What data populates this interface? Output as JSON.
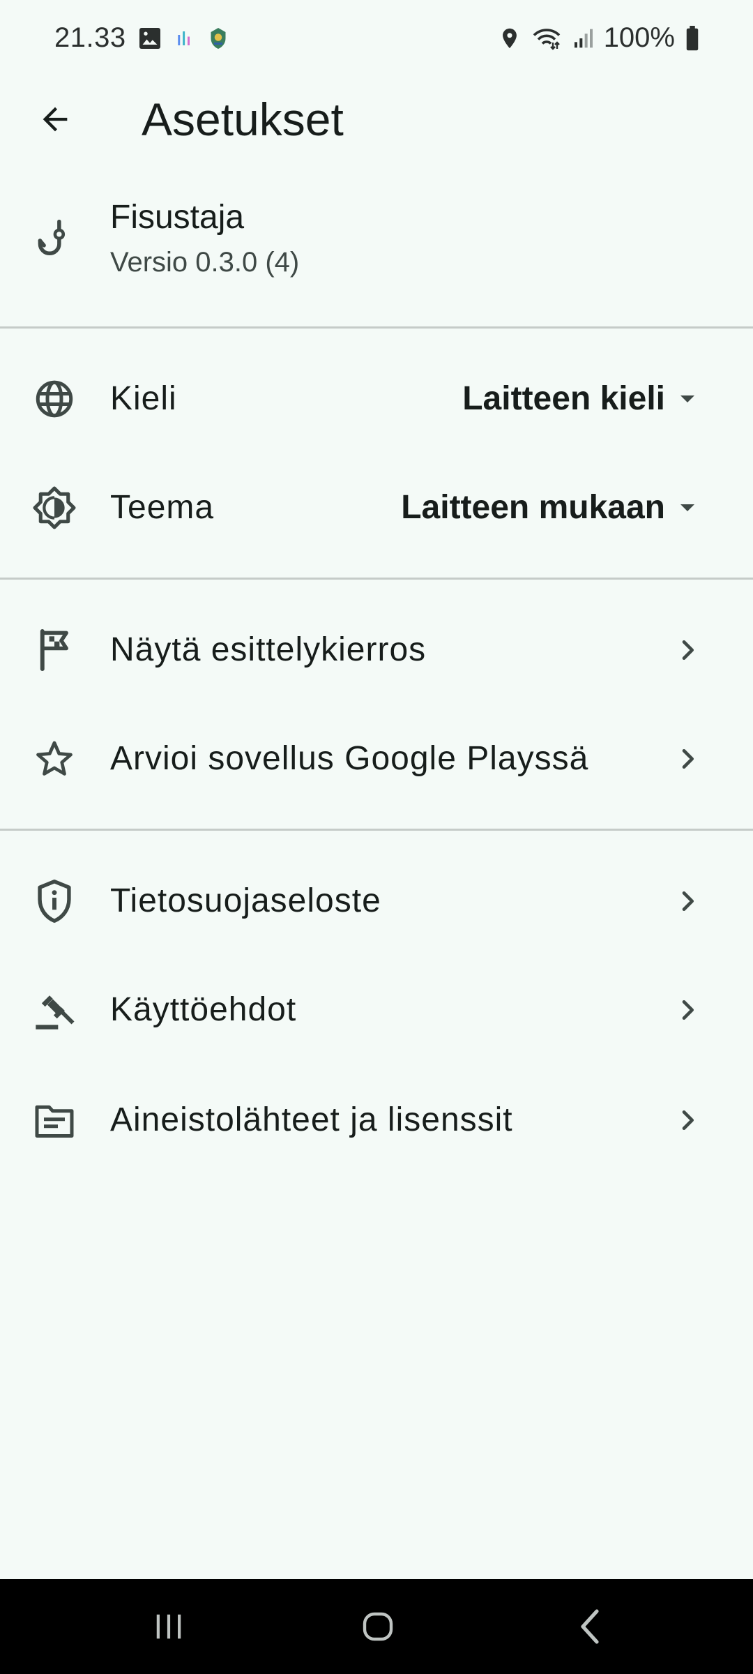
{
  "status_bar": {
    "time": "21.33",
    "battery": "100%",
    "icons": [
      "image-icon",
      "equalizer-icon",
      "app-emblem-icon",
      "location-icon",
      "wifi-icon",
      "signal-icon",
      "battery-icon"
    ]
  },
  "app_bar": {
    "title": "Asetukset",
    "back_icon": "arrow-back-icon"
  },
  "app_info": {
    "name": "Fisustaja",
    "version": "Versio 0.3.0 (4)",
    "icon": "fishing-hook-icon"
  },
  "settings": {
    "language": {
      "label": "Kieli",
      "value": "Laitteen kieli",
      "icon": "globe-icon"
    },
    "theme": {
      "label": "Teema",
      "value": "Laitteen mukaan",
      "icon": "brightness-icon"
    }
  },
  "links": {
    "tour": {
      "label": "Näytä esittelykierros",
      "icon": "flag-icon"
    },
    "rate": {
      "label": "Arvioi sovellus Google Playssä",
      "icon": "star-icon"
    },
    "privacy": {
      "label": "Tietosuojaseloste",
      "icon": "shield-icon"
    },
    "terms": {
      "label": "Käyttöehdot",
      "icon": "gavel-icon"
    },
    "licenses": {
      "label": "Aineistolähteet ja lisenssit",
      "icon": "document-icon"
    }
  },
  "colors": {
    "background": "#f4faf7",
    "text": "#171d1b",
    "divider": "#c5cbc8",
    "icon": "#3f4946",
    "nav_bar": "#000000"
  }
}
